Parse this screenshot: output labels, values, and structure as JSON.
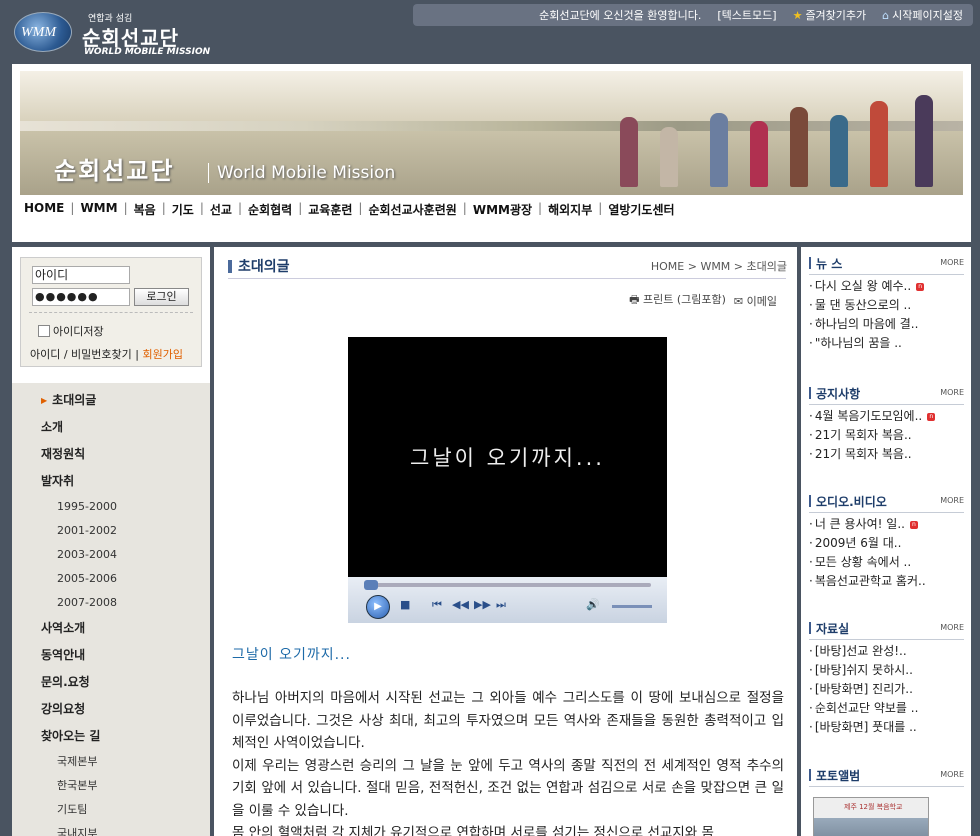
{
  "site": {
    "logo_globe": "WMM",
    "logo_small": "연합과 섬김",
    "logo_title": "순회선교단",
    "logo_eng": "WORLD MOBILE MISSION"
  },
  "topbar": {
    "welcome": "순회선교단에 오신것을 환영합니다.",
    "text_mode": "[텍스트모드]",
    "favorite": "즐겨찾기추가",
    "homepage": "시작페이지설정"
  },
  "banner": {
    "title_kr": "순회선교단",
    "title_en": "World Mobile Mission"
  },
  "gnb": [
    "HOME",
    "WMM",
    "복음",
    "기도",
    "선교",
    "순회협력",
    "교육훈련",
    "순회선교사훈련원",
    "WMM광장",
    "해외지부",
    "열방기도센터"
  ],
  "login": {
    "id_value": "아이디",
    "pw_value": "●●●●●●",
    "login_button": "로그인",
    "save_id": "아이디저장",
    "find": "아이디 / 비밀번호찾기",
    "separator": "|",
    "join": "회원가입"
  },
  "left_nav": [
    {
      "label": "초대의글",
      "type": "m",
      "current": true
    },
    {
      "label": "소개",
      "type": "m"
    },
    {
      "label": "재정원칙",
      "type": "m"
    },
    {
      "label": "발자취",
      "type": "m"
    },
    {
      "label": "1995-2000",
      "type": "s"
    },
    {
      "label": "2001-2002",
      "type": "s"
    },
    {
      "label": "2003-2004",
      "type": "s"
    },
    {
      "label": "2005-2006",
      "type": "s"
    },
    {
      "label": "2007-2008",
      "type": "s"
    },
    {
      "label": "사역소개",
      "type": "m"
    },
    {
      "label": "동역안내",
      "type": "m"
    },
    {
      "label": "문의.요청",
      "type": "m"
    },
    {
      "label": "강의요청",
      "type": "m"
    },
    {
      "label": "찾아오는 길",
      "type": "m"
    },
    {
      "label": "국제본부",
      "type": "s"
    },
    {
      "label": "한국본부",
      "type": "s"
    },
    {
      "label": "기도팀",
      "type": "s"
    },
    {
      "label": "국내지부",
      "type": "s"
    }
  ],
  "main": {
    "title": "초대의글",
    "breadcrumb": "HOME > WMM > 초대의글",
    "print": "프린트 (그림포함)",
    "email": "이메일",
    "video_caption": "그날이 오기까지...",
    "heading": "그날이 오기까지...",
    "paragraphs": [
      "하나님 아버지의 마음에서 시작된 선교는 그 외아들 예수 그리스도를 이 땅에 보내심으로 절정을 이루었습니다. 그것은 사상 최대, 최고의 투자였으며 모든 역사와 존재들을 동원한 총력적이고 입체적인 사역이었습니다.",
      "이제 우리는 영광스런 승리의 그 날을 눈 앞에 두고 역사의 종말 직전의 전 세계적인 영적 추수의 기회 앞에 서 있습니다. 절대 믿음, 전적헌신, 조건 없는 연합과 섬김으로 서로 손을 맞잡으면 큰 일을 이룰 수 있습니다.",
      "몸 안의 혈액처럼 각 지체가 유기적으로 연합하며 서로를 섬기는 정신으로 선교지와 몸"
    ]
  },
  "right": {
    "more": "MORE",
    "news": {
      "title": "뉴 스",
      "items": [
        {
          "t": "다시 오실 왕 예수..",
          "new": true
        },
        {
          "t": "물 댄 동산으로의 .."
        },
        {
          "t": "하나님의 마음에 결.."
        },
        {
          "t": "\"하나님의 꿈을 .."
        }
      ]
    },
    "notice": {
      "title": "공지사항",
      "items": [
        {
          "t": "4월 복음기도모임에..",
          "new": true
        },
        {
          "t": "21기 목회자 복음.."
        },
        {
          "t": "21기 목회자 복음.."
        }
      ]
    },
    "av": {
      "title": "오디오.비디오",
      "items": [
        {
          "t": "너 큰 용사여! 일..",
          "new": true
        },
        {
          "t": "2009년 6월 대.."
        },
        {
          "t": "모든 상황 속에서 .."
        },
        {
          "t": "복음선교관학교 홈커.."
        }
      ]
    },
    "archive": {
      "title": "자료실",
      "items": [
        {
          "t": "[바탕]선교 완성!.."
        },
        {
          "t": "[바탕]쉬지 못하시.."
        },
        {
          "t": "[바탕화면] 진리가.."
        },
        {
          "t": "순회선교단 약보를 .."
        },
        {
          "t": "[바탕화면] 풋대를 .."
        }
      ]
    },
    "photo": {
      "title": "포토앨범",
      "caption": "제주 12월 복음학교"
    }
  },
  "colors": {
    "background": "#4a5461",
    "accent": "#1e3d6a",
    "link": "#1d6aa8",
    "new_badge": "#e03030"
  }
}
